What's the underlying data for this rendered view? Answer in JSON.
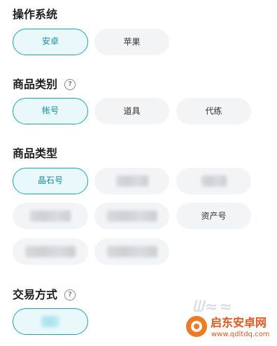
{
  "os_section": {
    "title": "操作系统",
    "options": [
      "安卓",
      "苹果"
    ]
  },
  "category_section": {
    "title": "商品类别",
    "help_glyph": "?",
    "options": [
      "帐号",
      "道具",
      "代练"
    ]
  },
  "type_section": {
    "title": "商品类型",
    "options": [
      "晶石号",
      "资产号"
    ]
  },
  "trade_section": {
    "title": "交易方式",
    "help_glyph": "?"
  },
  "watermark": {
    "name": "启东安卓网",
    "url": "www.qdltdq.com"
  },
  "colors": {
    "accent": "#1aa8b7",
    "chip_bg": "#f3f4f6",
    "active_bg": "#e9f9fb",
    "watermark": "#e8561c"
  }
}
